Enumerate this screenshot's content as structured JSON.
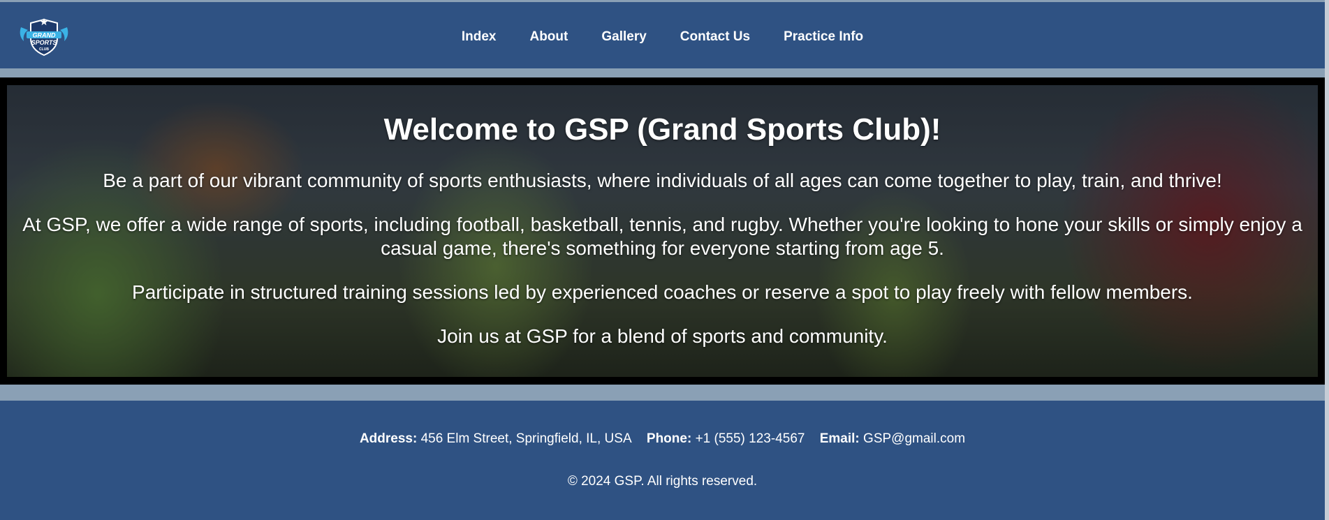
{
  "header": {
    "logo_alt": "Grand Sports Club logo",
    "logo_text": [
      "GRAND",
      "SPORTS",
      "CLUB"
    ],
    "nav": [
      {
        "label": "Index"
      },
      {
        "label": "About"
      },
      {
        "label": "Gallery"
      },
      {
        "label": "Contact Us"
      },
      {
        "label": "Practice Info"
      }
    ]
  },
  "hero": {
    "title": "Welcome to GSP (Grand Sports Club)!",
    "paragraphs": [
      "Be a part of our vibrant community of sports enthusiasts, where individuals of all ages can come together to play, train, and thrive!",
      "At GSP, we offer a wide range of sports, including football, basketball, tennis, and rugby. Whether you're looking to hone your skills or simply enjoy a casual game, there's something for everyone starting from age 5.",
      "Participate in structured training sessions led by experienced coaches or reserve a spot to play freely with fellow members.",
      "Join us at GSP for a blend of sports and community."
    ]
  },
  "footer": {
    "address_label": "Address:",
    "address": "456 Elm Street, Springfield, IL, USA",
    "phone_label": "Phone:",
    "phone": "+1 (555) 123-4567",
    "email_label": "Email:",
    "email": "GSP@gmail.com",
    "copyright": "© 2024 GSP. All rights reserved."
  },
  "colors": {
    "header_bg": "#2f5283",
    "page_bg": "#8aa0b5",
    "text": "#ffffff",
    "logo_accent": "#3bb3e6"
  }
}
